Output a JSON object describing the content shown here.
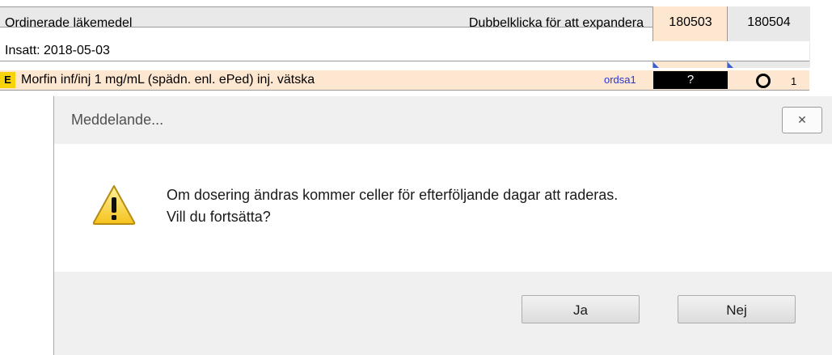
{
  "grid": {
    "header_label": "Ordinerade läkemedel",
    "hint": "Dubbelklicka för att expandera",
    "dates": [
      "180503",
      "180504"
    ],
    "inserted": "Insatt: 2018-05-03",
    "drug_badge": "E",
    "drug_name": "Morfin inf/inj 1 mg/mL (spädn. enl. ePed) inj. vätska",
    "drug_tag": "ordsa1",
    "unknown_cell": "?",
    "dose_count": "1"
  },
  "dialog": {
    "title": "Meddelande...",
    "close_glyph": "✕",
    "icon": "warning-icon",
    "message_line1": "Om dosering ändras kommer celler för efterföljande dagar att raderas.",
    "message_line2": "Vill du fortsätta?",
    "yes_label": "Ja",
    "no_label": "Nej"
  }
}
